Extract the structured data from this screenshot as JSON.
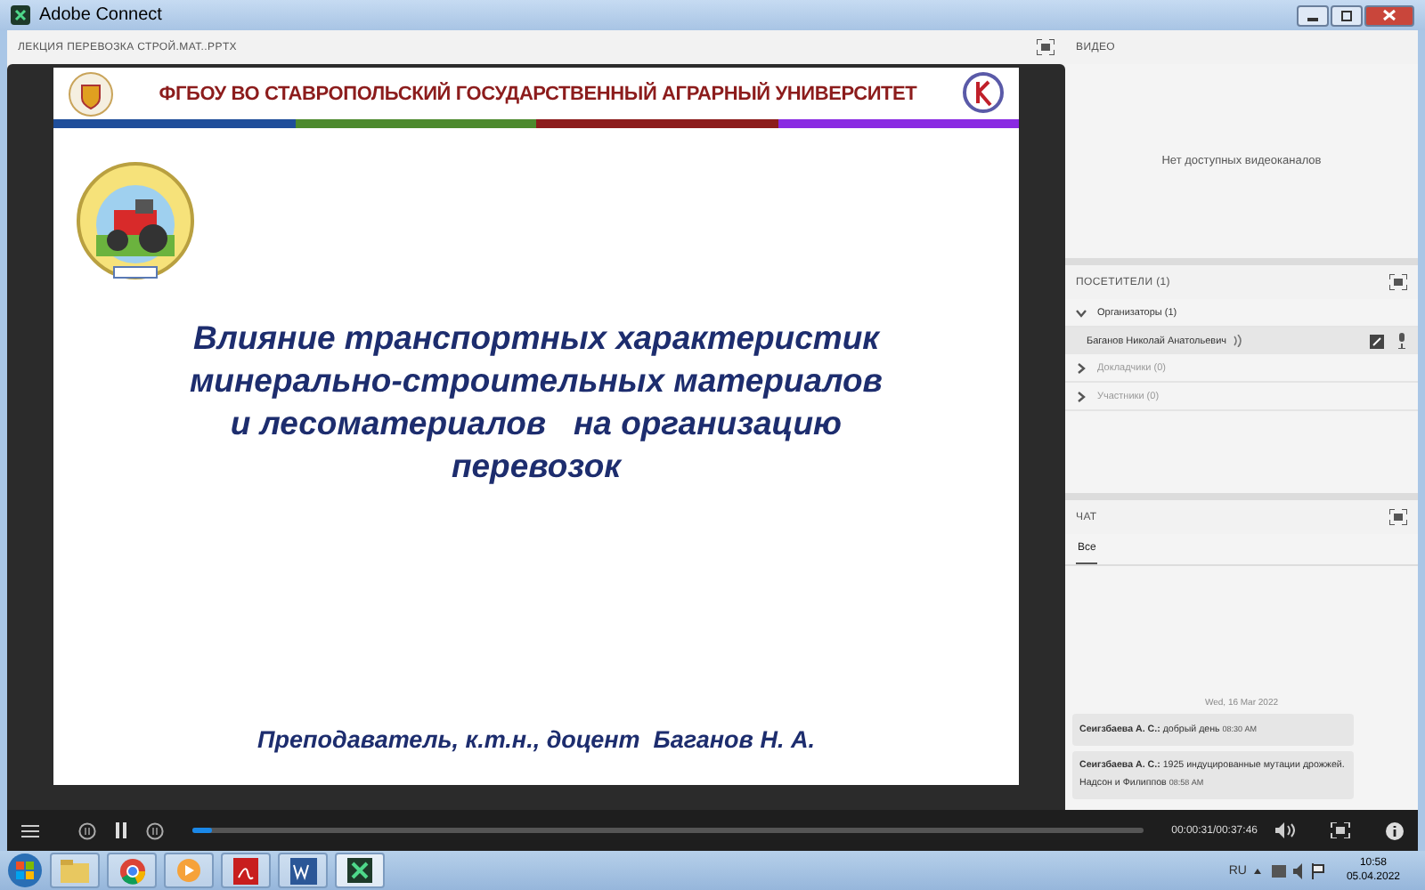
{
  "window": {
    "title": "Adobe Connect"
  },
  "share_pod": {
    "title": "ЛЕКЦИЯ ПЕРЕВОЗКА СТРОЙ.МАТ..PPTX"
  },
  "slide": {
    "university": "ФГБОУ ВО СТАВРОПОЛЬСКИЙ ГОСУДАРСТВЕННЫЙ АГРАРНЫЙ УНИВЕРСИТЕТ",
    "stripe": [
      {
        "color": "#1f4e9a"
      },
      {
        "color": "#4d8a2e"
      },
      {
        "color": "#8c1c1c"
      },
      {
        "color": "#8a2be2"
      }
    ],
    "title_lines": [
      "Влияние транспортных характеристик",
      "минерально-строительных материалов",
      "и лесоматериалов   на организацию",
      "перевозок"
    ],
    "lecturer": "Преподаватель, к.т.н., доцент  Баганов Н. А."
  },
  "video_pod": {
    "title": "ВИДЕО",
    "message": "Нет доступных видеоканалов"
  },
  "attendees_pod": {
    "title": "ПОСЕТИТЕЛИ  (1)",
    "groups": [
      {
        "label": "Организаторы (1)",
        "expanded": true,
        "children": [
          {
            "name": "Баганов Николай Анатольевич"
          }
        ]
      },
      {
        "label": "Докладчики (0)",
        "expanded": false
      },
      {
        "label": "Участники (0)",
        "expanded": false
      }
    ]
  },
  "chat_pod": {
    "title": "ЧАТ",
    "tabs": [
      {
        "label": "Все",
        "selected": true
      }
    ],
    "date": "Wed, 16 Mar 2022",
    "messages": [
      {
        "author": "Сеигзбаева А. С.:",
        "text": "добрый день",
        "time": "08:30 AM"
      },
      {
        "author": "Сеигзбаева А. С.:",
        "text": "1925 индуцированные мутации дрожжей. Надсон и Филиппов",
        "time": "08:58 AM"
      }
    ]
  },
  "player": {
    "time": "00:00:31/00:37:46",
    "level": 0.02
  },
  "taskbar": {
    "language": "RU",
    "time": "10:58",
    "date": "05.04.2022"
  }
}
